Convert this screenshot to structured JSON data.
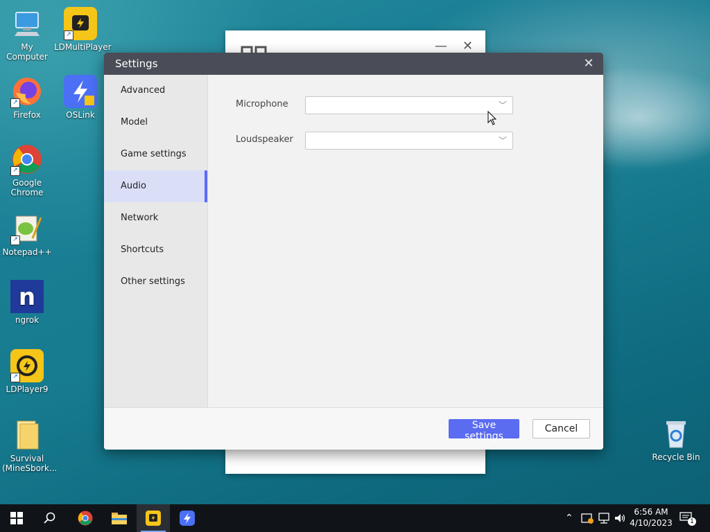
{
  "desktop": {
    "icons": [
      {
        "label": "My Computer",
        "icon": "computer-icon"
      },
      {
        "label": "LDMultiPlayer",
        "icon": "ldmultiplayer-icon"
      },
      {
        "label": "Firefox",
        "icon": "firefox-icon"
      },
      {
        "label": "OSLink",
        "icon": "oslink-icon"
      },
      {
        "label": "Google Chrome",
        "icon": "chrome-icon"
      },
      {
        "label": "Notepad++",
        "icon": "notepadpp-icon"
      },
      {
        "label": "ngrok",
        "icon": "ngrok-icon"
      },
      {
        "label": "LDPlayer9",
        "icon": "ldplayer-icon"
      },
      {
        "label": "Survival (MineSbork...",
        "icon": "folder-icon"
      },
      {
        "label": "Recycle Bin",
        "icon": "recycle-bin-icon"
      }
    ]
  },
  "dialog": {
    "title": "Settings",
    "close_glyph": "✕",
    "sidebar": {
      "items": [
        {
          "label": "Advanced",
          "active": false
        },
        {
          "label": "Model",
          "active": false
        },
        {
          "label": "Game settings",
          "active": false
        },
        {
          "label": "Audio",
          "active": true
        },
        {
          "label": "Network",
          "active": false
        },
        {
          "label": "Shortcuts",
          "active": false
        },
        {
          "label": "Other settings",
          "active": false
        }
      ]
    },
    "audio": {
      "microphone_label": "Microphone",
      "microphone_value": "",
      "loudspeaker_label": "Loudspeaker",
      "loudspeaker_value": ""
    },
    "footer": {
      "save_label": "Save settings",
      "cancel_label": "Cancel"
    }
  },
  "taskbar": {
    "clock_time": "6:56 AM",
    "clock_date": "4/10/2023",
    "notification_count": "1"
  },
  "colors": {
    "accent": "#5b6cf0",
    "titlebar": "#4a4d57",
    "taskbar": "#101418"
  }
}
